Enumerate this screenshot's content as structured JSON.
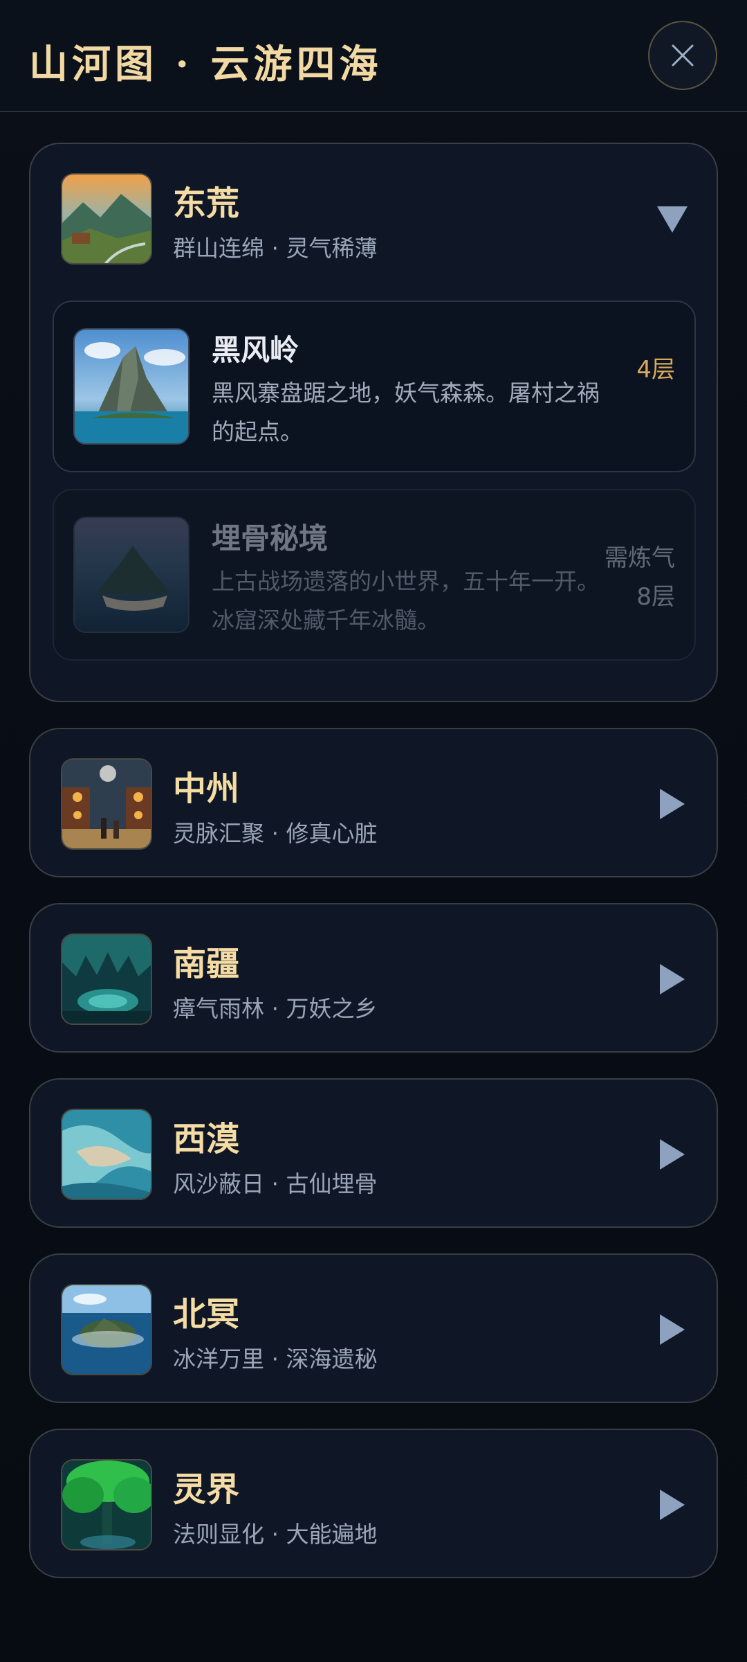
{
  "header": {
    "title": "山河图 · 云游四海",
    "close_icon": "close-icon"
  },
  "colors": {
    "accent_gold": "#f5dca4",
    "level_gold": "#d9a85a",
    "arrow": "#8ea2bf"
  },
  "regions": [
    {
      "name": "东荒",
      "desc": "群山连绵 · 灵气稀薄",
      "expanded": true,
      "icon": "chevron-down-icon",
      "sublocations": [
        {
          "name": "黑风岭",
          "desc": "黑风寨盘踞之地，妖气森森。屠村之祸的起点。",
          "tag": "4层",
          "locked": false
        },
        {
          "name": "埋骨秘境",
          "desc": "上古战场遗落的小世界，五十年一开。冰窟深处藏千年冰髓。",
          "tag": "需炼气8层",
          "locked": true
        }
      ]
    },
    {
      "name": "中州",
      "desc": "灵脉汇聚 · 修真心脏",
      "expanded": false,
      "icon": "chevron-right-icon"
    },
    {
      "name": "南疆",
      "desc": "瘴气雨林 · 万妖之乡",
      "expanded": false,
      "icon": "chevron-right-icon"
    },
    {
      "name": "西漠",
      "desc": "风沙蔽日 · 古仙埋骨",
      "expanded": false,
      "icon": "chevron-right-icon"
    },
    {
      "name": "北冥",
      "desc": "冰洋万里 · 深海遗秘",
      "expanded": false,
      "icon": "chevron-right-icon"
    },
    {
      "name": "灵界",
      "desc": "法则显化 · 大能遍地",
      "expanded": false,
      "icon": "chevron-right-icon"
    }
  ]
}
